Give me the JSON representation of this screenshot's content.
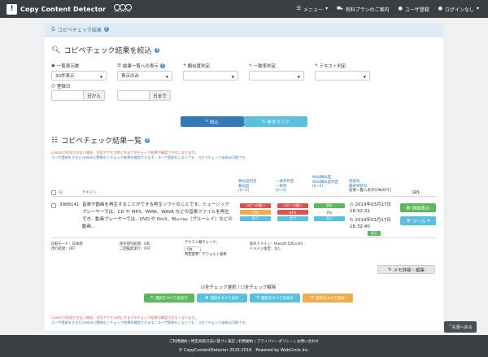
{
  "nav": {
    "brand": "Copy Content Detector",
    "circle_sub": "WEBCIRCLE INC.",
    "menu": "メニュー",
    "paid": "有料プランのご案内",
    "register": "ユーザ登録",
    "login": "ログインなし"
  },
  "panel_title": "コピペチェック結果",
  "filter": {
    "title": "コピペチェック結果を絞込",
    "display_count_label": "一覧表示数",
    "display_count_value": "30件表示",
    "list_display_label": "結果一覧への表示",
    "list_display_value": "表示のみ",
    "similarity_label": "類似度判定",
    "match_label": "一致率判定",
    "text_label": "テキスト判定",
    "date_label": "登録日",
    "from_label": "日から",
    "to_label": "日まで",
    "search_btn": "絞込",
    "clear_btn": "条件クリア"
  },
  "results": {
    "title": "コピペチェック結果一覧",
    "notice1": "cookieが利用できない場合、次回アクセス時に今までのチェック結果が確認できなくなります。",
    "notice2": "ユーザ登録をするとcookieに関係なくチェック結果を確認できます。ユーザ登録をしなくても、コピペチェック自体は可能です。",
    "headers": {
      "id": "ID",
      "text": "テキスト",
      "similarity": "類似度判定",
      "similarity2": "類似度",
      "similarity3": "[0~0]",
      "match": "一致率判定",
      "match2": "一致率",
      "match3": "[0~0]",
      "check": "Web類似度",
      "check2": "Web類似度判定",
      "check3": "[0~0]",
      "registered": "登録日",
      "updated": "最終更新日",
      "listdisp": "結果一覧へ表示[ON/OFF]",
      "ops": "操作"
    },
    "row": {
      "id": "3988141",
      "text": "音楽や動画を再生することができる再生ソフトのことです。ミュージックプレーヤーでは、CD や MP3、WMA、WAVE などの音楽ファイルを再生でき、動画プレーヤーでは、DVD や DivX、Blu-ray（ブルーレイ）などの動画...",
      "sim_badge": "コピーの疑い",
      "sim_pct": "71%",
      "sim_done": "完了",
      "match_badge": "コピーの疑い",
      "match_pct": "84%",
      "match_done": "完了",
      "check_badge": "良好",
      "check_pct": "0%",
      "check_done": "完了",
      "date1": "2019年03月17日 16:32:31",
      "date2": "2019年03月17日 16:32:40",
      "listflag": "表示",
      "detail_btn": "詳細表示",
      "tool_btn": "ツール"
    },
    "meta": {
      "mode": "比較モード：日本語",
      "hide": "改行処理：OFF",
      "dup": "除外語句処理：ON",
      "eng": "二回検索実行：OFF",
      "check_label": "テキスト類チェック：",
      "check_val": "ON",
      "check_note": "判定基準：デフォルト基準",
      "domain": "除外ドメイン：thesoft.100.com",
      "domain2": "ドメイン指定：なし"
    },
    "memo_btn": "メモ詳細・編集",
    "check_all": "全チェック選択",
    "uncheck_all": "全チェック解除",
    "act1": "選択をすべて再実行",
    "act2": "選択をすべて表示",
    "act3": "選択をすべて非表示",
    "act4": "選択をすべて削除"
  },
  "back_top": "先頭へ戻る",
  "footer": {
    "links": "ご利用規約 | 特定商取引法に基づく表記 | 利用規約 | プライバシーポリシー | お問い合わせ",
    "copy": "© CopyContentDetector 2015-2019　Powered by WebCircle Inc."
  }
}
